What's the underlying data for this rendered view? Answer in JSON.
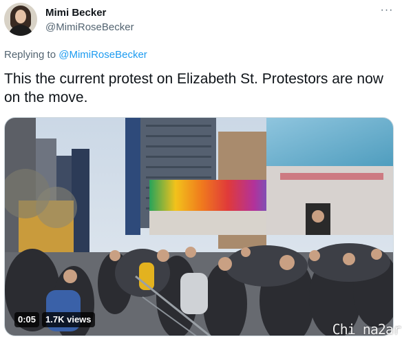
{
  "author": {
    "display_name": "Mimi Becker",
    "handle": "@MimiRoseBecker",
    "avatar_icon": "profile-photo"
  },
  "more_icon": "more-horizontal-icon",
  "more_label": "···",
  "reply": {
    "prefix": "Replying to ",
    "mention": "@MimiRoseBecker"
  },
  "tweet": {
    "text": "This the current protest on Elizabeth St. Protestors are now on the move."
  },
  "video": {
    "time": "0:05",
    "views": "1.7K views"
  },
  "watermark": "Chi na2ar",
  "colors": {
    "link": "#1d9bf0",
    "secondary_text": "#536471"
  }
}
